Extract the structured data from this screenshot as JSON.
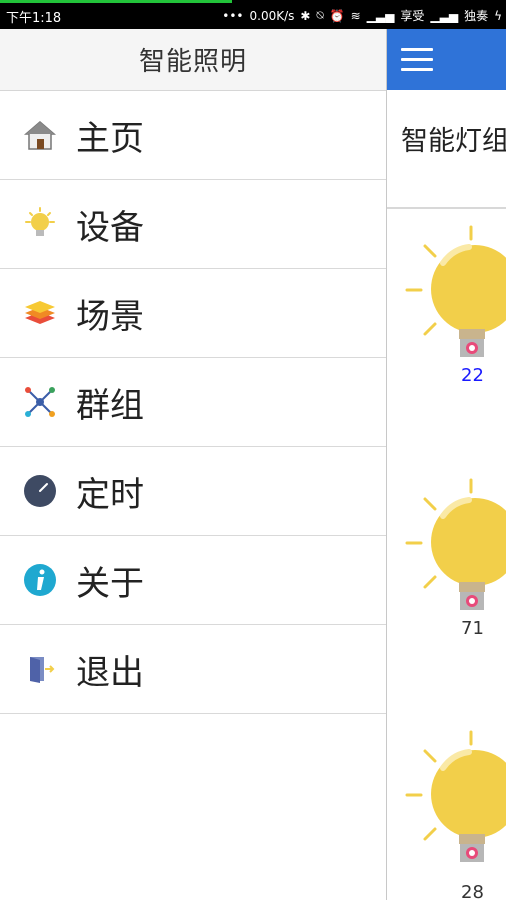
{
  "status_bar": {
    "time": "下午1:18",
    "network_speed": "0.00K/s",
    "carrier1": "享受",
    "carrier2": "独奏"
  },
  "drawer": {
    "title": "智能照明",
    "items": [
      {
        "label": "主页",
        "icon": "home-icon"
      },
      {
        "label": "设备",
        "icon": "lightbulb-icon"
      },
      {
        "label": "场景",
        "icon": "layers-icon"
      },
      {
        "label": "群组",
        "icon": "network-icon"
      },
      {
        "label": "定时",
        "icon": "clock-icon"
      },
      {
        "label": "关于",
        "icon": "info-icon"
      },
      {
        "label": "退出",
        "icon": "exit-door-icon"
      }
    ]
  },
  "main": {
    "group_title": "智能灯组",
    "lamps": [
      {
        "value": "22",
        "color": "#1a1aff"
      },
      {
        "value": "71",
        "color": "#333333"
      },
      {
        "value": "28",
        "color": "#333333"
      }
    ]
  },
  "colors": {
    "app_bar": "#2f73d8",
    "bulb": "#f2cf4a"
  }
}
